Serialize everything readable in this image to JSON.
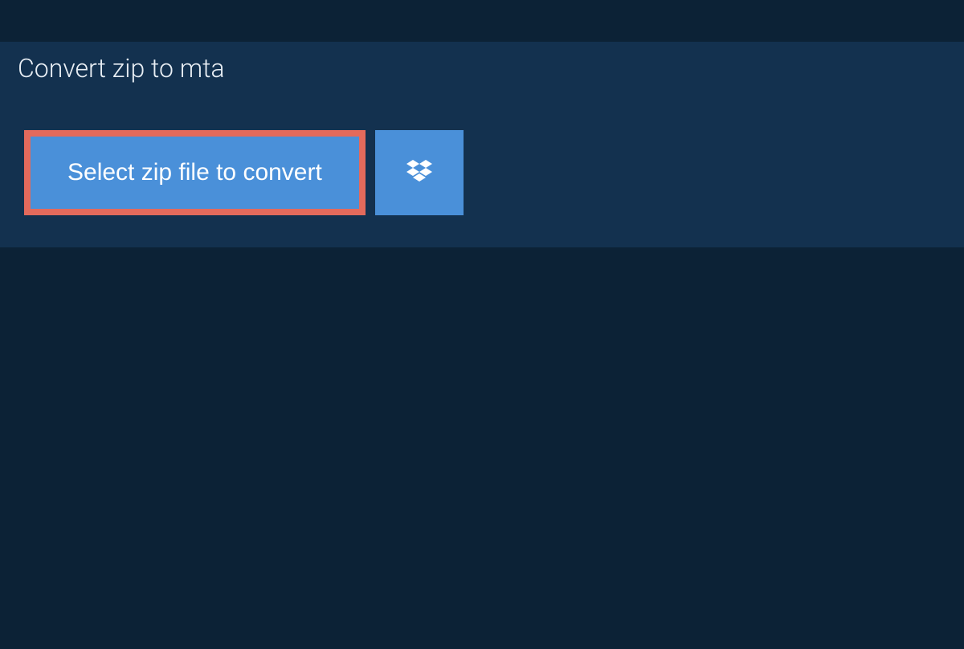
{
  "header": {
    "tab_label": "Convert zip to mta"
  },
  "upload": {
    "select_button_label": "Select zip file to convert"
  },
  "colors": {
    "background_dark": "#0c2236",
    "background_panel": "#13314f",
    "button_primary": "#4a90d9",
    "highlight_border": "#e36a5c"
  }
}
